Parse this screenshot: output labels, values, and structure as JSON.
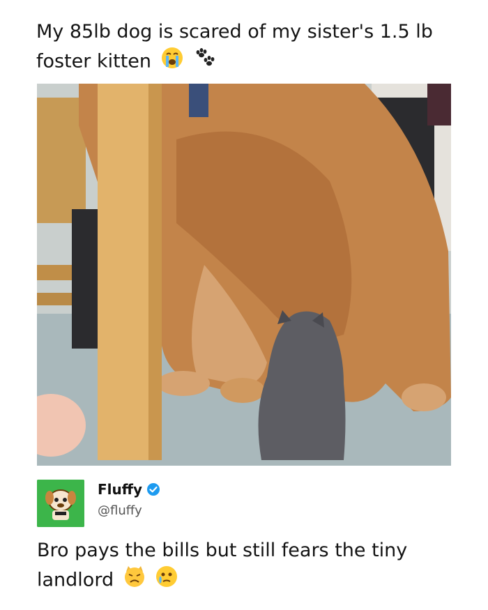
{
  "post": {
    "title": "My 85lb dog is scared of my sister's 1.5 lb foster kitten",
    "title_emojis": [
      "crying-face-emoji",
      "paw-prints-emoji"
    ]
  },
  "photo": {
    "subject": "golden-retriever-and-kitten-photo"
  },
  "author": {
    "name": "Fluffy",
    "handle": "@fluffy",
    "verified": true,
    "avatar_color": "#3cb54a",
    "verified_color": "#1d9bf0"
  },
  "caption": {
    "text": "Bro pays the bills but still fears the tiny landlord",
    "emojis": [
      "pouting-cat-emoji",
      "face-holding-back-tears-emoji"
    ]
  }
}
